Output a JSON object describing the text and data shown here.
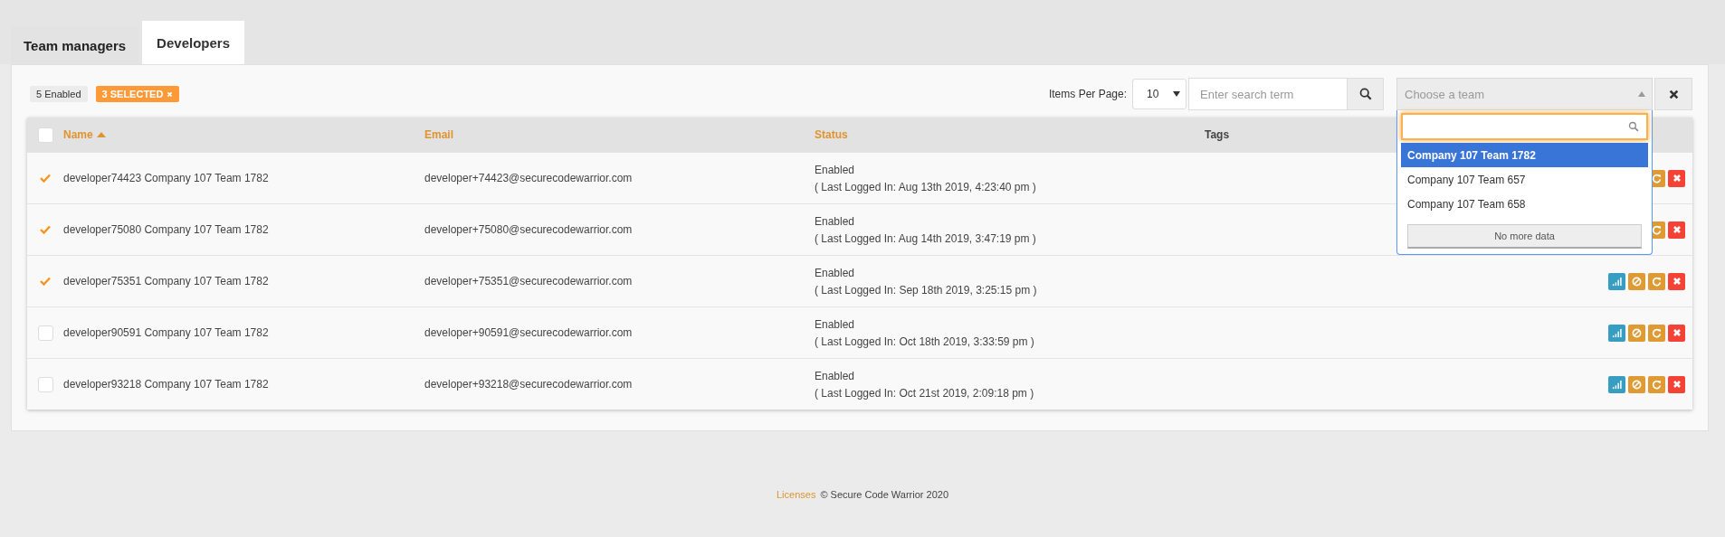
{
  "tabs": [
    {
      "label": "Team managers",
      "selected": false
    },
    {
      "label": "Developers",
      "selected": true
    }
  ],
  "badges": {
    "enabled_count": "5 Enabled",
    "selected_count": "3 SELECTED"
  },
  "toolbar": {
    "items_per_page_label": "Items Per Page:",
    "items_per_page": "10",
    "search": {
      "placeholder": "Enter search term"
    },
    "team_select": {
      "placeholder": "Choose a team",
      "expanded": true
    }
  },
  "team_dropdown": {
    "options": [
      {
        "label": "Company 107 Team 1782",
        "selected": true
      },
      {
        "label": "Company 107 Team 657",
        "selected": false
      },
      {
        "label": "Company 107 Team 658",
        "selected": false
      }
    ],
    "footer": "No more data"
  },
  "table": {
    "select_all_checked": false,
    "columns": [
      {
        "label": "Name",
        "sorted": true,
        "kind": "accent"
      },
      {
        "label": "Email",
        "sorted": false,
        "kind": "accent"
      },
      {
        "label": "Status",
        "sorted": false,
        "kind": "accent"
      },
      {
        "label": "Tags",
        "sorted": false,
        "kind": "plain"
      }
    ],
    "rows": [
      {
        "selected": true,
        "name": "developer74423 Company 107 Team 1782",
        "email": "developer+74423@securecodewarrior.com",
        "status": "Enabled",
        "last_login": "( Last Logged In: Aug 13th 2019, 4:23:40 pm )",
        "actions": [
          {
            "kind": "reset"
          },
          {
            "kind": "delete"
          }
        ]
      },
      {
        "selected": true,
        "name": "developer75080 Company 107 Team 1782",
        "email": "developer+75080@securecodewarrior.com",
        "status": "Enabled",
        "last_login": "( Last Logged In: Aug 14th 2019, 3:47:19 pm )",
        "actions": [
          {
            "kind": "reset"
          },
          {
            "kind": "delete"
          }
        ]
      },
      {
        "selected": true,
        "name": "developer75351 Company 107 Team 1782",
        "email": "developer+75351@securecodewarrior.com",
        "status": "Enabled",
        "last_login": "( Last Logged In: Sep 18th 2019, 3:25:15 pm )",
        "actions": [
          {
            "kind": "stats"
          },
          {
            "kind": "block"
          },
          {
            "kind": "reset"
          },
          {
            "kind": "delete"
          }
        ]
      },
      {
        "selected": false,
        "name": "developer90591 Company 107 Team 1782",
        "email": "developer+90591@securecodewarrior.com",
        "status": "Enabled",
        "last_login": "( Last Logged In: Oct 18th 2019, 3:33:59 pm )",
        "actions": [
          {
            "kind": "stats"
          },
          {
            "kind": "block"
          },
          {
            "kind": "reset"
          },
          {
            "kind": "delete"
          }
        ]
      },
      {
        "selected": false,
        "name": "developer93218 Company 107 Team 1782",
        "email": "developer+93218@securecodewarrior.com",
        "status": "Enabled",
        "last_login": "( Last Logged In: Oct 21st 2019, 2:09:18 pm )",
        "actions": [
          {
            "kind": "stats"
          },
          {
            "kind": "block"
          },
          {
            "kind": "reset"
          },
          {
            "kind": "delete"
          }
        ]
      }
    ]
  },
  "footer": {
    "link": "Licenses",
    "text": "© Secure Code Warrior 2020"
  }
}
